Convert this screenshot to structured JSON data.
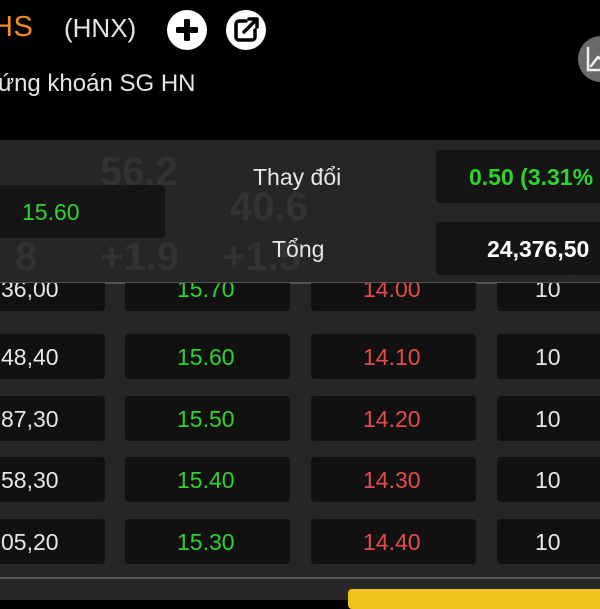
{
  "header": {
    "symbol": "HS",
    "exchange": "(HNX)",
    "company_name": "ứng khoán SG HN"
  },
  "quote": {
    "price": "15.60",
    "change_label": "Thay đổi",
    "change_value": "0.50 (3.31%",
    "total_label": "Tổng",
    "total_value": "24,376,50"
  },
  "order_book": [
    {
      "volume": "36,00",
      "bid": "15.70",
      "ask": "14.00",
      "qty": "10"
    },
    {
      "volume": "48,40",
      "bid": "15.60",
      "ask": "14.10",
      "qty": "10"
    },
    {
      "volume": "87,30",
      "bid": "15.50",
      "ask": "14.20",
      "qty": "10"
    },
    {
      "volume": "58,30",
      "bid": "15.40",
      "ask": "14.30",
      "qty": "10"
    },
    {
      "volume": "05,20",
      "bid": "15.30",
      "ask": "14.40",
      "qty": "10"
    }
  ],
  "colors": {
    "symbol": "#f28c1e",
    "up": "#2fd32f",
    "down": "#e64a4a",
    "action": "#f2c318"
  },
  "icons": [
    "add-icon",
    "share-icon",
    "chart-icon"
  ]
}
